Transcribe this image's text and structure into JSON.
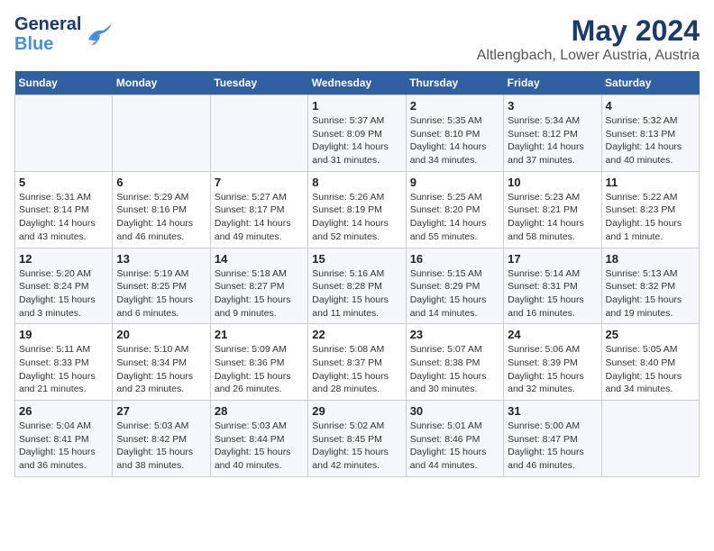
{
  "header": {
    "logo_line1": "General",
    "logo_line2": "Blue",
    "title": "May 2024",
    "subtitle": "Altlengbach, Lower Austria, Austria"
  },
  "days_of_week": [
    "Sunday",
    "Monday",
    "Tuesday",
    "Wednesday",
    "Thursday",
    "Friday",
    "Saturday"
  ],
  "weeks": [
    [
      {
        "day": "",
        "info": ""
      },
      {
        "day": "",
        "info": ""
      },
      {
        "day": "",
        "info": ""
      },
      {
        "day": "1",
        "info": "Sunrise: 5:37 AM\nSunset: 8:09 PM\nDaylight: 14 hours\nand 31 minutes."
      },
      {
        "day": "2",
        "info": "Sunrise: 5:35 AM\nSunset: 8:10 PM\nDaylight: 14 hours\nand 34 minutes."
      },
      {
        "day": "3",
        "info": "Sunrise: 5:34 AM\nSunset: 8:12 PM\nDaylight: 14 hours\nand 37 minutes."
      },
      {
        "day": "4",
        "info": "Sunrise: 5:32 AM\nSunset: 8:13 PM\nDaylight: 14 hours\nand 40 minutes."
      }
    ],
    [
      {
        "day": "5",
        "info": "Sunrise: 5:31 AM\nSunset: 8:14 PM\nDaylight: 14 hours\nand 43 minutes."
      },
      {
        "day": "6",
        "info": "Sunrise: 5:29 AM\nSunset: 8:16 PM\nDaylight: 14 hours\nand 46 minutes."
      },
      {
        "day": "7",
        "info": "Sunrise: 5:27 AM\nSunset: 8:17 PM\nDaylight: 14 hours\nand 49 minutes."
      },
      {
        "day": "8",
        "info": "Sunrise: 5:26 AM\nSunset: 8:19 PM\nDaylight: 14 hours\nand 52 minutes."
      },
      {
        "day": "9",
        "info": "Sunrise: 5:25 AM\nSunset: 8:20 PM\nDaylight: 14 hours\nand 55 minutes."
      },
      {
        "day": "10",
        "info": "Sunrise: 5:23 AM\nSunset: 8:21 PM\nDaylight: 14 hours\nand 58 minutes."
      },
      {
        "day": "11",
        "info": "Sunrise: 5:22 AM\nSunset: 8:23 PM\nDaylight: 15 hours\nand 1 minute."
      }
    ],
    [
      {
        "day": "12",
        "info": "Sunrise: 5:20 AM\nSunset: 8:24 PM\nDaylight: 15 hours\nand 3 minutes."
      },
      {
        "day": "13",
        "info": "Sunrise: 5:19 AM\nSunset: 8:25 PM\nDaylight: 15 hours\nand 6 minutes."
      },
      {
        "day": "14",
        "info": "Sunrise: 5:18 AM\nSunset: 8:27 PM\nDaylight: 15 hours\nand 9 minutes."
      },
      {
        "day": "15",
        "info": "Sunrise: 5:16 AM\nSunset: 8:28 PM\nDaylight: 15 hours\nand 11 minutes."
      },
      {
        "day": "16",
        "info": "Sunrise: 5:15 AM\nSunset: 8:29 PM\nDaylight: 15 hours\nand 14 minutes."
      },
      {
        "day": "17",
        "info": "Sunrise: 5:14 AM\nSunset: 8:31 PM\nDaylight: 15 hours\nand 16 minutes."
      },
      {
        "day": "18",
        "info": "Sunrise: 5:13 AM\nSunset: 8:32 PM\nDaylight: 15 hours\nand 19 minutes."
      }
    ],
    [
      {
        "day": "19",
        "info": "Sunrise: 5:11 AM\nSunset: 8:33 PM\nDaylight: 15 hours\nand 21 minutes."
      },
      {
        "day": "20",
        "info": "Sunrise: 5:10 AM\nSunset: 8:34 PM\nDaylight: 15 hours\nand 23 minutes."
      },
      {
        "day": "21",
        "info": "Sunrise: 5:09 AM\nSunset: 8:36 PM\nDaylight: 15 hours\nand 26 minutes."
      },
      {
        "day": "22",
        "info": "Sunrise: 5:08 AM\nSunset: 8:37 PM\nDaylight: 15 hours\nand 28 minutes."
      },
      {
        "day": "23",
        "info": "Sunrise: 5:07 AM\nSunset: 8:38 PM\nDaylight: 15 hours\nand 30 minutes."
      },
      {
        "day": "24",
        "info": "Sunrise: 5:06 AM\nSunset: 8:39 PM\nDaylight: 15 hours\nand 32 minutes."
      },
      {
        "day": "25",
        "info": "Sunrise: 5:05 AM\nSunset: 8:40 PM\nDaylight: 15 hours\nand 34 minutes."
      }
    ],
    [
      {
        "day": "26",
        "info": "Sunrise: 5:04 AM\nSunset: 8:41 PM\nDaylight: 15 hours\nand 36 minutes."
      },
      {
        "day": "27",
        "info": "Sunrise: 5:03 AM\nSunset: 8:42 PM\nDaylight: 15 hours\nand 38 minutes."
      },
      {
        "day": "28",
        "info": "Sunrise: 5:03 AM\nSunset: 8:44 PM\nDaylight: 15 hours\nand 40 minutes."
      },
      {
        "day": "29",
        "info": "Sunrise: 5:02 AM\nSunset: 8:45 PM\nDaylight: 15 hours\nand 42 minutes."
      },
      {
        "day": "30",
        "info": "Sunrise: 5:01 AM\nSunset: 8:46 PM\nDaylight: 15 hours\nand 44 minutes."
      },
      {
        "day": "31",
        "info": "Sunrise: 5:00 AM\nSunset: 8:47 PM\nDaylight: 15 hours\nand 46 minutes."
      },
      {
        "day": "",
        "info": ""
      }
    ]
  ]
}
